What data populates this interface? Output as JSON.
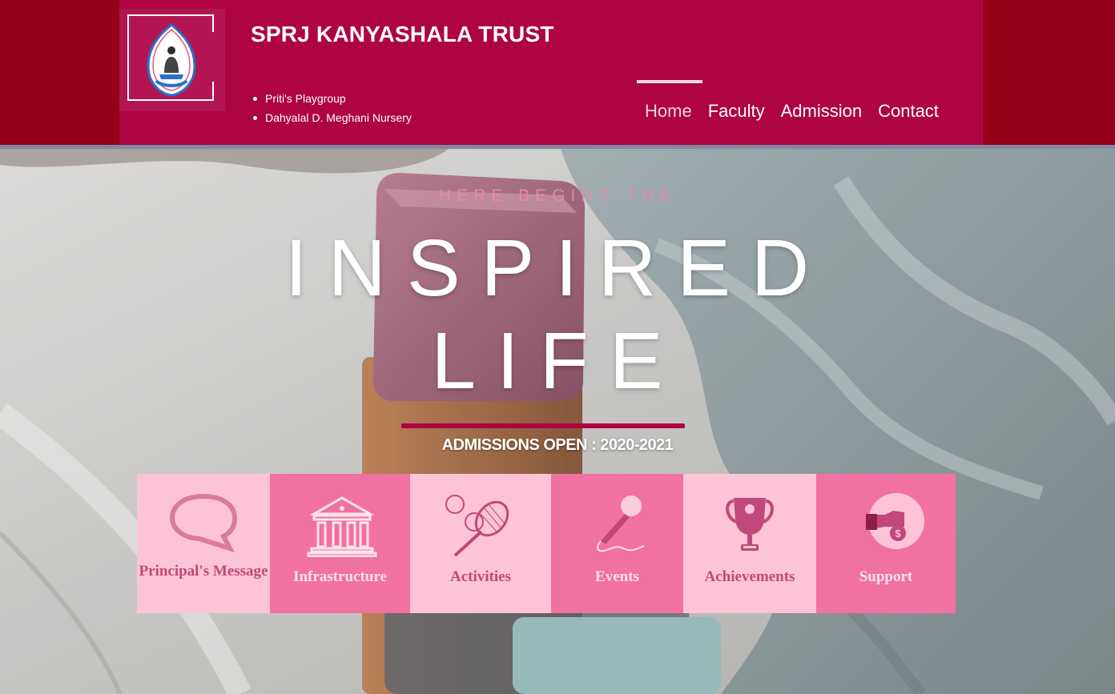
{
  "header": {
    "title": "SPRJ KANYASHALA TRUST",
    "sub_items": [
      "Priti's Playgroup",
      "Dahyalal D. Meghani Nursery"
    ],
    "nav": [
      {
        "label": "Home",
        "active": true
      },
      {
        "label": "Faculty",
        "active": false
      },
      {
        "label": "Admission",
        "active": false
      },
      {
        "label": "Contact",
        "active": false
      }
    ]
  },
  "hero": {
    "eyebrow": "HERE BEGINS THE",
    "headline_line1": "INSPIRED",
    "headline_line2": "LIFE",
    "admissions": "ADMISSIONS OPEN : 2020-2021"
  },
  "tiles": [
    {
      "label": "Principal's Message",
      "icon": "speech-bubble-icon"
    },
    {
      "label": "Infrastructure",
      "icon": "building-icon"
    },
    {
      "label": "Activities",
      "icon": "tennis-icon"
    },
    {
      "label": "Events",
      "icon": "microphone-icon"
    },
    {
      "label": "Achievements",
      "icon": "trophy-icon"
    },
    {
      "label": "Support",
      "icon": "donation-icon"
    }
  ],
  "colors": {
    "header_bg": "#ae0442",
    "header_outer": "#960019",
    "tile_light": "#fdc3d6",
    "tile_dark": "#f171a0",
    "accent": "#ae0442"
  }
}
